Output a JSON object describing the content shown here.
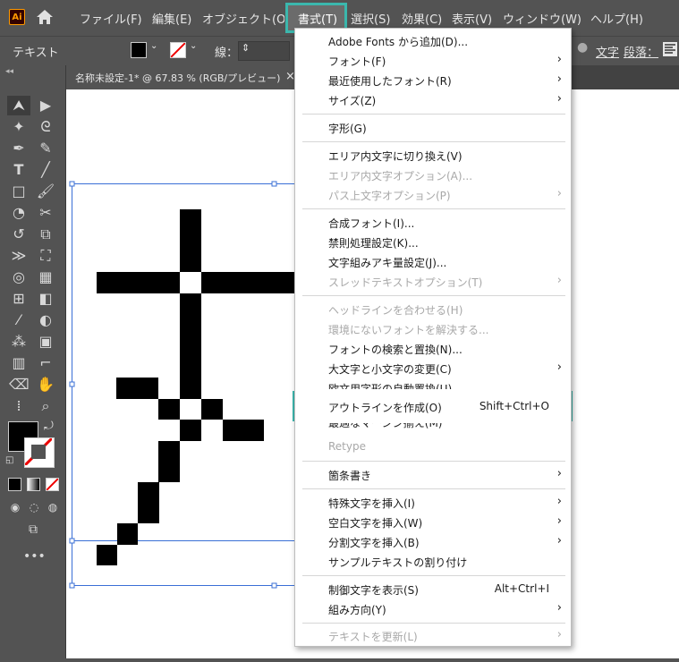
{
  "app": {
    "logo": "Ai"
  },
  "menubar": {
    "items": [
      "ファイル(F)",
      "編集(E)",
      "オブジェクト(O",
      "書式(T)",
      "選択(S)",
      "効果(C)",
      "表示(V)",
      "ウィンドウ(W)",
      "ヘルプ(H)"
    ]
  },
  "control": {
    "mode": "テキスト",
    "stroke_label": "線：",
    "char_label": "文字",
    "para_label": "段落："
  },
  "document": {
    "tab_title": "名称未設定-1* @ 67.83 % (RGB/プレビュー)",
    "close": "×"
  },
  "type_menu": {
    "items": [
      {
        "label": "Adobe Fonts から追加(D)...",
        "shortcut": "",
        "submenu": false,
        "disabled": false
      },
      {
        "label": "フォント(F)",
        "shortcut": "",
        "submenu": true,
        "disabled": false
      },
      {
        "label": "最近使用したフォント(R)",
        "shortcut": "",
        "submenu": true,
        "disabled": false
      },
      {
        "label": "サイズ(Z)",
        "shortcut": "",
        "submenu": true,
        "disabled": false
      },
      {
        "label": "字形(G)",
        "shortcut": "",
        "submenu": false,
        "disabled": false
      },
      {
        "label": "エリア内文字に切り換え(V)",
        "shortcut": "",
        "submenu": false,
        "disabled": false
      },
      {
        "label": "エリア内文字オプション(A)...",
        "shortcut": "",
        "submenu": false,
        "disabled": true
      },
      {
        "label": "パス上文字オプション(P)",
        "shortcut": "",
        "submenu": true,
        "disabled": true
      },
      {
        "label": "合成フォント(I)...",
        "shortcut": "",
        "submenu": false,
        "disabled": false
      },
      {
        "label": "禁則処理設定(K)...",
        "shortcut": "",
        "submenu": false,
        "disabled": false
      },
      {
        "label": "文字組みアキ量設定(J)...",
        "shortcut": "",
        "submenu": false,
        "disabled": false
      },
      {
        "label": "スレッドテキストオプション(T)",
        "shortcut": "",
        "submenu": true,
        "disabled": true
      },
      {
        "label": "ヘッドラインを合わせる(H)",
        "shortcut": "",
        "submenu": false,
        "disabled": true
      },
      {
        "label": "環境にないフォントを解決する...",
        "shortcut": "",
        "submenu": false,
        "disabled": true
      },
      {
        "label": "フォントの検索と置換(N)...",
        "shortcut": "",
        "submenu": false,
        "disabled": false
      },
      {
        "label": "大文字と小文字の変更(C)",
        "shortcut": "",
        "submenu": true,
        "disabled": false
      },
      {
        "label": "欧文用字形の自動置換(U)",
        "shortcut": "",
        "submenu": false,
        "disabled": false
      },
      {
        "label": "アウトラインを作成(O)",
        "shortcut": "Shift+Ctrl+O",
        "submenu": false,
        "disabled": false
      },
      {
        "label": "最適なマージン揃え(M)",
        "shortcut": "",
        "submenu": false,
        "disabled": false
      },
      {
        "label": "Retype",
        "shortcut": "",
        "submenu": false,
        "disabled": true
      },
      {
        "label": "箇条書き",
        "shortcut": "",
        "submenu": true,
        "disabled": false
      },
      {
        "label": "特殊文字を挿入(I)",
        "shortcut": "",
        "submenu": true,
        "disabled": false
      },
      {
        "label": "空白文字を挿入(W)",
        "shortcut": "",
        "submenu": true,
        "disabled": false
      },
      {
        "label": "分割文字を挿入(B)",
        "shortcut": "",
        "submenu": true,
        "disabled": false
      },
      {
        "label": "サンプルテキストの割り付け",
        "shortcut": "",
        "submenu": false,
        "disabled": false
      },
      {
        "label": "制御文字を表示(S)",
        "shortcut": "Alt+Ctrl+I",
        "submenu": false,
        "disabled": false
      },
      {
        "label": "組み方向(Y)",
        "shortcut": "",
        "submenu": true,
        "disabled": false
      },
      {
        "label": "テキストを更新(L)",
        "shortcut": "",
        "submenu": true,
        "disabled": true
      }
    ]
  },
  "colors": {
    "highlight": "#3bb7ad",
    "canvas": "#ffffff",
    "panel": "#535353"
  }
}
